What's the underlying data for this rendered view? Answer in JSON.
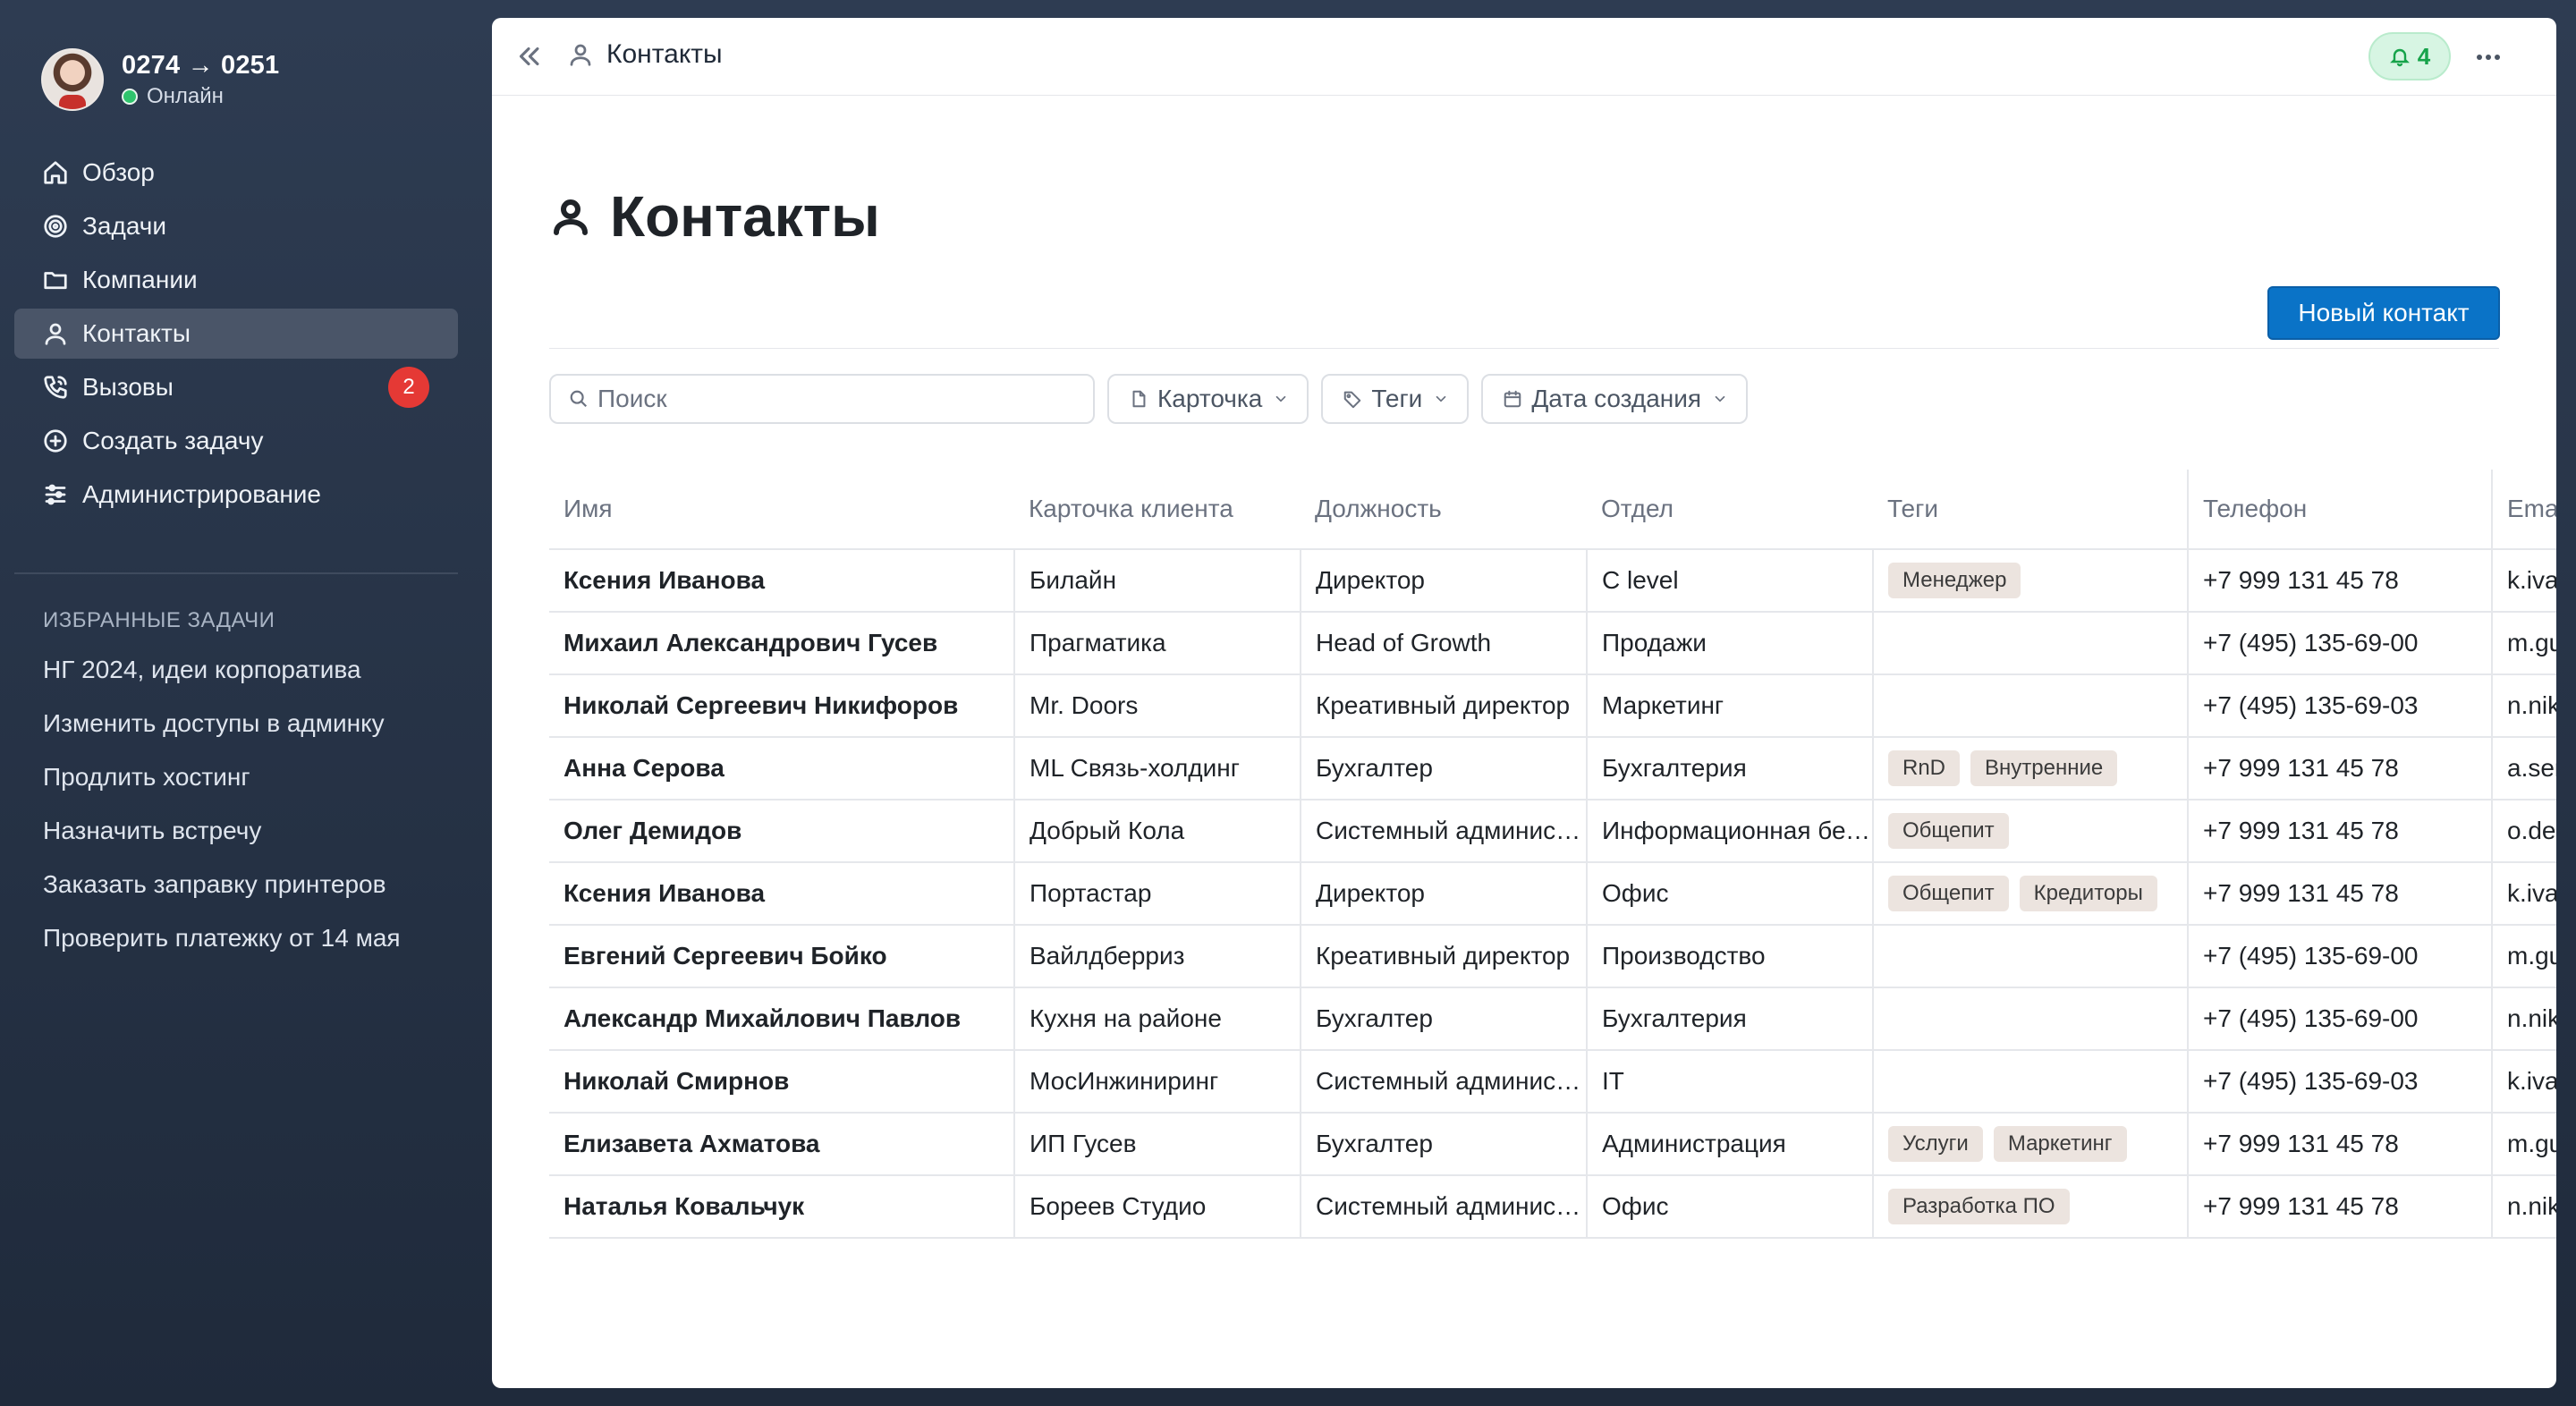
{
  "user": {
    "name": "0274 → 0251",
    "status": "Онлайн"
  },
  "nav": [
    {
      "label": "Обзор",
      "icon": "home-icon"
    },
    {
      "label": "Задачи",
      "icon": "target-icon"
    },
    {
      "label": "Компании",
      "icon": "folder-icon"
    },
    {
      "label": "Контакты",
      "icon": "user-icon",
      "active": true
    },
    {
      "label": "Вызовы",
      "icon": "phone-icon",
      "badge": "2"
    },
    {
      "label": "Создать задачу",
      "icon": "plus-circle-icon"
    },
    {
      "label": "Администрирование",
      "icon": "sliders-icon"
    }
  ],
  "favorites": {
    "title": "ИЗБРАННЫЕ ЗАДАЧИ",
    "items": [
      "НГ 2024, идеи корпоратива",
      "Изменить доступы в админку",
      "Продлить хостинг",
      "Назначить встречу",
      "Заказать заправку принтеров",
      "Проверить платежку от 14 мая"
    ]
  },
  "topbar": {
    "breadcrumb": "Контакты",
    "notifications": "4"
  },
  "page": {
    "title": "Контакты",
    "new_button": "Новый контакт"
  },
  "filters": {
    "search_placeholder": "Поиск",
    "card": "Карточка",
    "tags": "Теги",
    "created": "Дата создания"
  },
  "table": {
    "columns": [
      "Имя",
      "Карточка клиента",
      "Должность",
      "Отдел",
      "Теги",
      "Телефон",
      "Email"
    ],
    "rows": [
      {
        "name": "Ксения Иванова",
        "card": "Билайн",
        "position": "Директор",
        "dept": "C level",
        "tags": [
          "Менеджер"
        ],
        "phone": "+7 999 131 45 78",
        "email": "k.ivanova@mail.ru"
      },
      {
        "name": "Михаил Александрович Гусев",
        "card": "Прагматика",
        "position": "Head of Growth",
        "dept": "Продажи",
        "tags": [],
        "phone": "+7 (495) 135-69-00",
        "email": "m.gusev@mail.ru"
      },
      {
        "name": "Николай Сергеевич Никифоров",
        "card": "Mr. Doors",
        "position": "Креативный директор",
        "dept": "Маркетинг",
        "tags": [],
        "phone": "+7 (495) 135-69-03",
        "email": "n.nikiforov@mail.ru"
      },
      {
        "name": "Анна Серова",
        "card": "ML Связь-холдинг",
        "position": "Бухгалтер",
        "dept": "Бухгалтерия",
        "tags": [
          "RnD",
          "Внутренние"
        ],
        "phone": "+7 999 131 45 78",
        "email": "a.serova@mail.ru"
      },
      {
        "name": "Олег Демидов",
        "card": "Добрый Кола",
        "position": "Системный администратор",
        "dept": "Информационная безопасность",
        "tags": [
          "Общепит"
        ],
        "phone": "+7 999 131 45 78",
        "email": "o.demidov@mail.ru"
      },
      {
        "name": "Ксения Иванова",
        "card": "Портастар",
        "position": "Директор",
        "dept": "Офис",
        "tags": [
          "Общепит",
          "Кредиторы"
        ],
        "phone": "+7 999 131 45 78",
        "email": "k.ivanova@mail.ru"
      },
      {
        "name": "Евгений Сергеевич Бойко",
        "card": "Вайлдберриз",
        "position": "Креативный директор",
        "dept": "Производство",
        "tags": [],
        "phone": "+7 (495) 135-69-00",
        "email": "m.gusev@mail.ru"
      },
      {
        "name": "Александр Михайлович Павлов",
        "card": "Кухня на районе",
        "position": "Бухгалтер",
        "dept": "Бухгалтерия",
        "tags": [],
        "phone": "+7 (495) 135-69-00",
        "email": "n.nikiforov@mail.ru"
      },
      {
        "name": "Николай Смирнов",
        "card": "МосИнжиниринг",
        "position": "Системный администратор",
        "dept": "IT",
        "tags": [],
        "phone": "+7 (495) 135-69-03",
        "email": "k.ivanova@mail.ru"
      },
      {
        "name": "Елизавета Ахматова",
        "card": "ИП Гусев",
        "position": "Бухгалтер",
        "dept": "Администрация",
        "tags": [
          "Услуги",
          "Маркетинг"
        ],
        "phone": "+7 999 131 45 78",
        "email": "m.gusev@mail.ru"
      },
      {
        "name": "Наталья Ковальчук",
        "card": "Бореев Студио",
        "position": "Системный администратор",
        "dept": "Офис",
        "tags": [
          "Разработка ПО"
        ],
        "phone": "+7 999 131 45 78",
        "email": "n.nikiforov@mail.ru"
      }
    ]
  },
  "colors": {
    "accent": "#0a73c7",
    "badge": "#e53935",
    "online": "#2fc46d",
    "notif": "#16a34a",
    "tag_bg": "#ece4df"
  }
}
